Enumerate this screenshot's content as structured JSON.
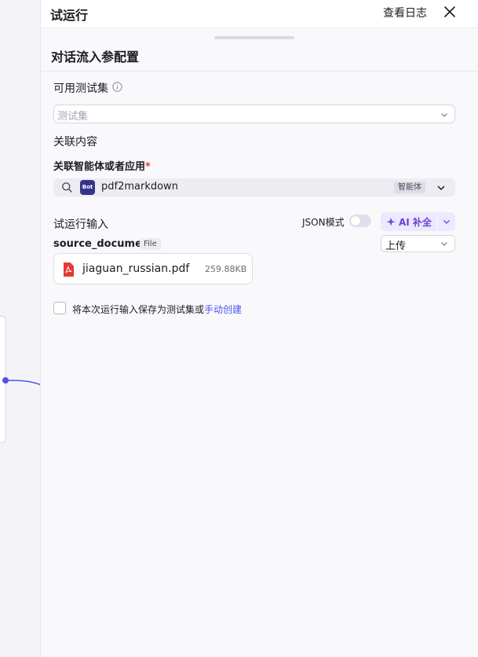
{
  "header": {
    "title": "试运行",
    "log_label": "查看日志"
  },
  "section": {
    "title": "对话流入参配置"
  },
  "testset": {
    "label": "可用测试集",
    "placeholder": "测试集"
  },
  "related": {
    "label": "关联内容",
    "agent_label": "关联智能体或者应用",
    "required_mark": "*",
    "agent_name": "pdf2markdown",
    "badge_text": "Bot",
    "agent_tag": "智能体"
  },
  "run_input": {
    "label": "试运行输入",
    "json_mode_label": "JSON模式",
    "json_mode_on": false,
    "ai_button_label": "AI 补全"
  },
  "field": {
    "name": "source_document",
    "type_tag": "File",
    "upload_option": "上传",
    "file_name": "jiaguan_russian.pdf",
    "file_size": "259.88KB"
  },
  "save": {
    "text": "将本次运行输入保存为测试集或",
    "link": "手动创建",
    "checked": false
  },
  "colors": {
    "accent": "#4d53e8",
    "ai_purple": "#6a3fd9",
    "bot_badge": "#37338c",
    "pdf_red": "#e53935"
  }
}
